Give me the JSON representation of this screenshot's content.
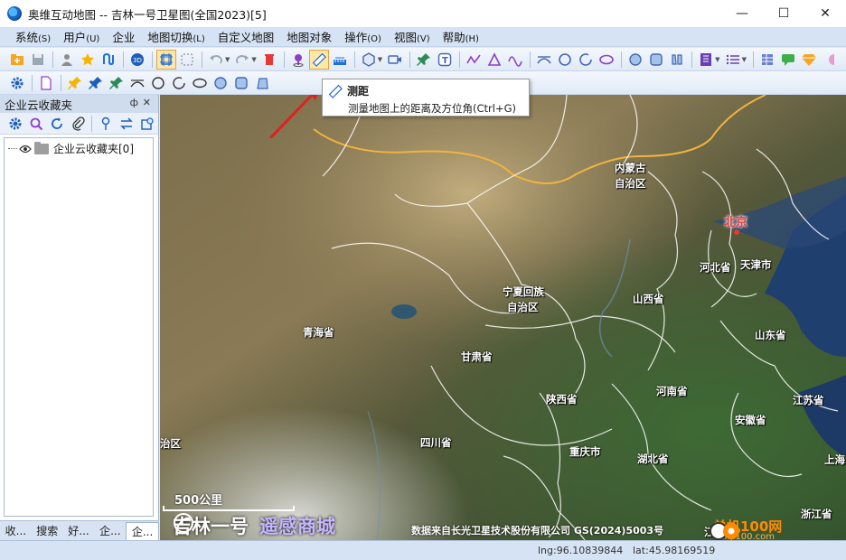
{
  "window": {
    "title": "奥维互动地图 -- 吉林一号卫星图(全国2023)[5]",
    "controls": [
      "—",
      "☐",
      "✕"
    ]
  },
  "menu": [
    {
      "label": "系统",
      "acc": "(S)"
    },
    {
      "label": "用户",
      "acc": "(U)"
    },
    {
      "label": "企业",
      "acc": ""
    },
    {
      "label": "地图切换",
      "acc": "(L)"
    },
    {
      "label": "自定义地图",
      "acc": ""
    },
    {
      "label": "地图对象",
      "acc": ""
    },
    {
      "label": "操作",
      "acc": "(O)"
    },
    {
      "label": "视图",
      "acc": "(V)"
    },
    {
      "label": "帮助",
      "acc": "(H)"
    }
  ],
  "tooltip": {
    "title": "测距",
    "description": "测量地图上的距离及方位角(Ctrl+G)"
  },
  "left_panel": {
    "title": "企业云收藏夹",
    "pin": "ф",
    "close": "✕",
    "tree": [
      {
        "label": "企业云收藏夹[0]"
      }
    ],
    "tabs": [
      "收...",
      "搜索",
      "好...",
      "企...",
      "企..."
    ]
  },
  "map": {
    "labels": {
      "neimenggu_1": "内蒙古",
      "neimenggu_2": "自治区",
      "beijing": "北京",
      "hebei": "河北省",
      "tianjin": "天津市",
      "ningxia_1": "宁夏回族",
      "ningxia_2": "自治区",
      "shanxi": "山西省",
      "qinghai": "青海省",
      "gansu": "甘肃省",
      "shandong": "山东省",
      "shaanxi": "陕西省",
      "henan": "河南省",
      "jiangsu": "江苏省",
      "anhui": "安徽省",
      "zizhiqu_edge": "治区",
      "sichuan": "四川省",
      "chongqing": "重庆市",
      "hubei": "湖北省",
      "shanghai": "上海",
      "zhejiang": "浙江省",
      "jiangxi": "江西"
    },
    "scale_label": "500公里",
    "brand_1": "吉林一号",
    "brand_2": "遥感商城",
    "copyright": "数据来自长光卫星技术股份有限公司 GS(2024)5003号",
    "watermark_1": "单机100网",
    "watermark_2": "danji100.com"
  },
  "status": {
    "lng": "lng:96.10839844",
    "lat": "lat:45.98169519"
  },
  "colors": {
    "boundary": "#f2b33d",
    "province_line": "#ffffff",
    "capital": "#e53935",
    "arrow": "#e02020"
  }
}
